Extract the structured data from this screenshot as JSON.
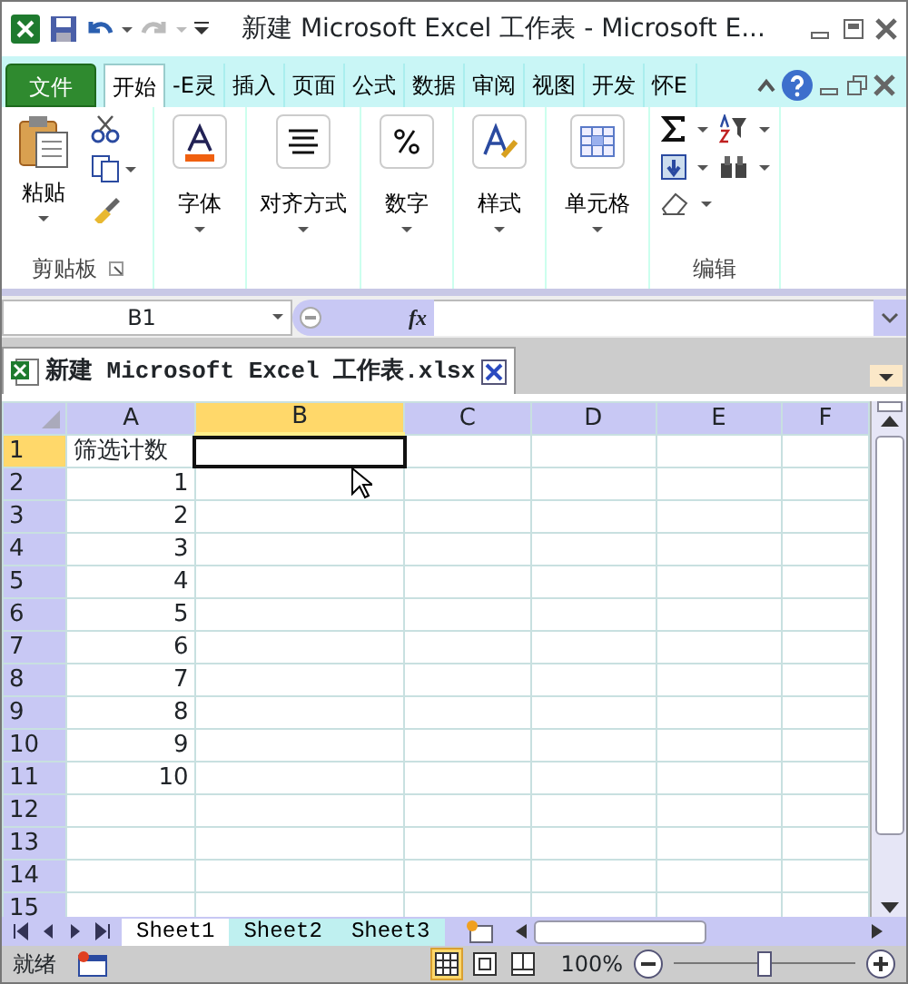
{
  "title_bar": {
    "title": "新建 Microsoft Excel 工作表  -  Microsoft E..."
  },
  "ribbon_tabs": [
    {
      "label": "文件",
      "kind": "file",
      "selected": false
    },
    {
      "label": "开始",
      "kind": "tab",
      "selected": true
    },
    {
      "label": "-E灵",
      "kind": "tab",
      "selected": false
    },
    {
      "label": "插入",
      "kind": "tab",
      "selected": false
    },
    {
      "label": "页面",
      "kind": "tab",
      "selected": false
    },
    {
      "label": "公式",
      "kind": "tab",
      "selected": false
    },
    {
      "label": "数据",
      "kind": "tab",
      "selected": false
    },
    {
      "label": "审阅",
      "kind": "tab",
      "selected": false
    },
    {
      "label": "视图",
      "kind": "tab",
      "selected": false
    },
    {
      "label": "开发",
      "kind": "tab",
      "selected": false
    },
    {
      "label": "怀E",
      "kind": "tab",
      "selected": false
    }
  ],
  "ribbon_groups": [
    {
      "kind": "clipboard",
      "label": "剪贴板",
      "button": "粘贴"
    },
    {
      "kind": "font",
      "button": "字体"
    },
    {
      "kind": "alignment",
      "button": "对齐方式"
    },
    {
      "kind": "number",
      "button": "数字"
    },
    {
      "kind": "styles",
      "button": "样式"
    },
    {
      "kind": "cells",
      "button": "单元格"
    },
    {
      "kind": "editing",
      "label": "编辑"
    }
  ],
  "formula_bar": {
    "name_box": "B1",
    "function_label": "fx"
  },
  "document_tab": {
    "title": "新建 Microsoft Excel 工作表.xlsx"
  },
  "columns": [
    {
      "label": "A",
      "selected": false
    },
    {
      "label": "B",
      "selected": true
    },
    {
      "label": "C",
      "selected": false
    },
    {
      "label": "D",
      "selected": false
    },
    {
      "label": "E",
      "selected": false
    },
    {
      "label": "F",
      "selected": false
    }
  ],
  "rows": [
    {
      "label": "1",
      "selected": true,
      "cells": [
        {
          "value": "筛选计数",
          "kind": "text"
        }
      ]
    },
    {
      "label": "2",
      "selected": false,
      "cells": [
        {
          "value": "1",
          "kind": "number"
        }
      ]
    },
    {
      "label": "3",
      "selected": false,
      "cells": [
        {
          "value": "2",
          "kind": "number"
        }
      ]
    },
    {
      "label": "4",
      "selected": false,
      "cells": [
        {
          "value": "3",
          "kind": "number"
        }
      ]
    },
    {
      "label": "5",
      "selected": false,
      "cells": [
        {
          "value": "4",
          "kind": "number"
        }
      ]
    },
    {
      "label": "6",
      "selected": false,
      "cells": [
        {
          "value": "5",
          "kind": "number"
        }
      ]
    },
    {
      "label": "7",
      "selected": false,
      "cells": [
        {
          "value": "6",
          "kind": "number"
        }
      ]
    },
    {
      "label": "8",
      "selected": false,
      "cells": [
        {
          "value": "7",
          "kind": "number"
        }
      ]
    },
    {
      "label": "9",
      "selected": false,
      "cells": [
        {
          "value": "8",
          "kind": "number"
        }
      ]
    },
    {
      "label": "10",
      "selected": false,
      "cells": [
        {
          "value": "9",
          "kind": "number"
        }
      ]
    },
    {
      "label": "11",
      "selected": false,
      "cells": [
        {
          "value": "10",
          "kind": "number"
        }
      ]
    },
    {
      "label": "12",
      "selected": false
    },
    {
      "label": "13",
      "selected": false
    },
    {
      "label": "14",
      "selected": false
    },
    {
      "label": "15",
      "selected": false
    }
  ],
  "sheet_tabs": [
    {
      "label": "Sheet1",
      "selected": true
    },
    {
      "label": "Sheet2",
      "selected": false
    },
    {
      "label": "Sheet3",
      "selected": false
    }
  ],
  "status_bar": {
    "status": "就绪",
    "view_buttons": [
      {
        "selected": true
      },
      {
        "selected": false
      },
      {
        "selected": false
      }
    ],
    "zoom": "100%",
    "zoom_slider": {
      "level": 0.5
    }
  }
}
